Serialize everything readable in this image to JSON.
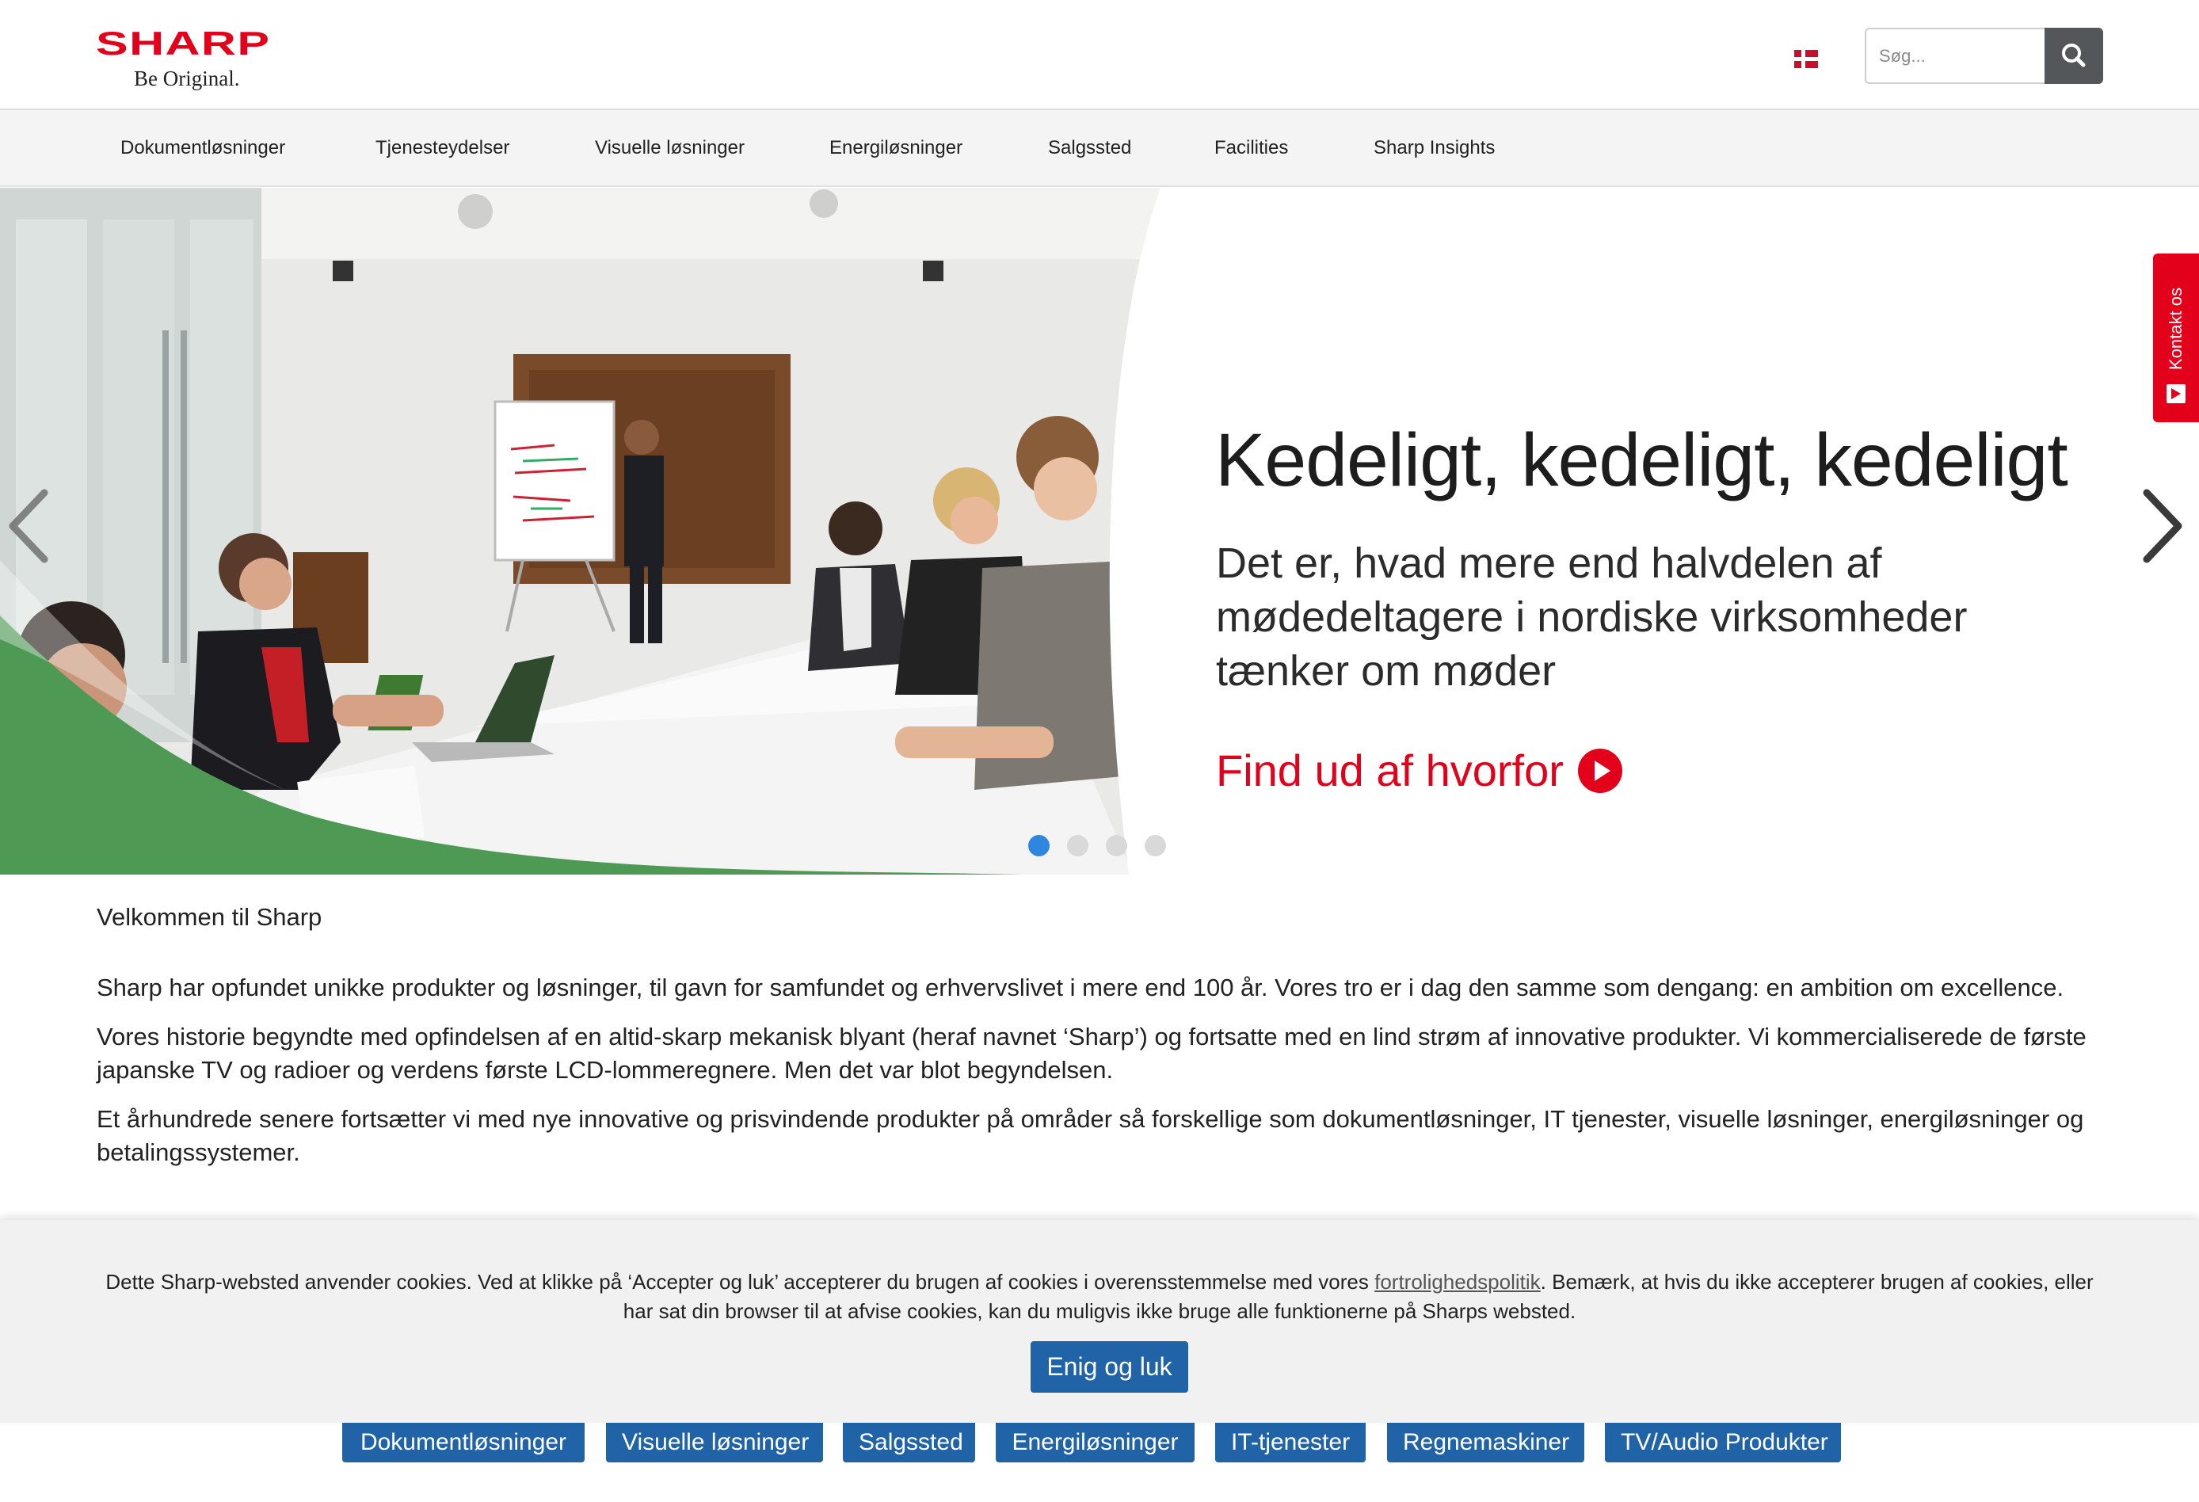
{
  "header": {
    "logo_word": "SHARP",
    "logo_tagline": "Be Original.",
    "language_flag": "denmark-flag-icon",
    "search": {
      "placeholder": "Søg..."
    }
  },
  "nav": {
    "items": [
      {
        "label": "Dokumentløsninger"
      },
      {
        "label": "Tjenesteydelser"
      },
      {
        "label": "Visuelle løsninger"
      },
      {
        "label": "Energiløsninger"
      },
      {
        "label": "Salgssted"
      },
      {
        "label": "Facilities"
      },
      {
        "label": "Sharp Insights"
      }
    ]
  },
  "hero": {
    "title": "Kedeligt, kedeligt, kedeligt",
    "subtitle": "Det er, hvad mere end halvdelen af mødedeltagere i nordiske virksomheder tænker om møder",
    "cta": "Find ud af hvorfor",
    "slides_total": 4,
    "active_slide": 1
  },
  "side_tab": {
    "label": "Kontakt os"
  },
  "content": {
    "welcome": "Velkommen til Sharp",
    "paragraphs": [
      "Sharp har opfundet unikke produkter og løsninger, til gavn for samfundet og erhvervslivet i mere end 100 år. Vores tro er i dag den samme som dengang: en ambition om excellence.",
      "Vores historie begyndte med opfindelsen af en altid-skarp mekanisk blyant (heraf navnet ‘Sharp’) og fortsatte med en lind strøm af innovative produkter. Vi kommercialiserede de første japanske TV og radioer og verdens første LCD-lommeregnere. Men det var blot begyndelsen.",
      "Et århundrede senere fortsætter vi med nye innovative og prisvindende produkter på områder så forskellige som dokumentløsninger, IT tjenester, visuelle løsninger, energiløsninger og betalingssystemer."
    ]
  },
  "cookie": {
    "text_before": "Dette Sharp-websted anvender cookies. Ved at klikke på ‘Accepter og luk’ accepterer du brugen af cookies i overensstemmelse med vores ",
    "link": "fortrolighedspolitik",
    "text_after": ". Bemærk, at hvis du ikke accepterer brugen af cookies, eller har sat din browser til at afvise cookies, kan du muligvis ikke bruge alle funktionerne på Sharps websted.",
    "button": "Enig og luk"
  },
  "categories": [
    {
      "label": "Dokumentløsninger"
    },
    {
      "label": "Visuelle løsninger"
    },
    {
      "label": "Salgssted"
    },
    {
      "label": "Energiløsninger"
    },
    {
      "label": "IT-tjenester"
    },
    {
      "label": "Regnemaskiner"
    },
    {
      "label": "TV/Audio Produkter"
    }
  ],
  "colors": {
    "brand_red": "#e3001b",
    "button_blue": "#2063a6",
    "active_dot": "#2e86de",
    "hero_green": "#4e9a55"
  }
}
